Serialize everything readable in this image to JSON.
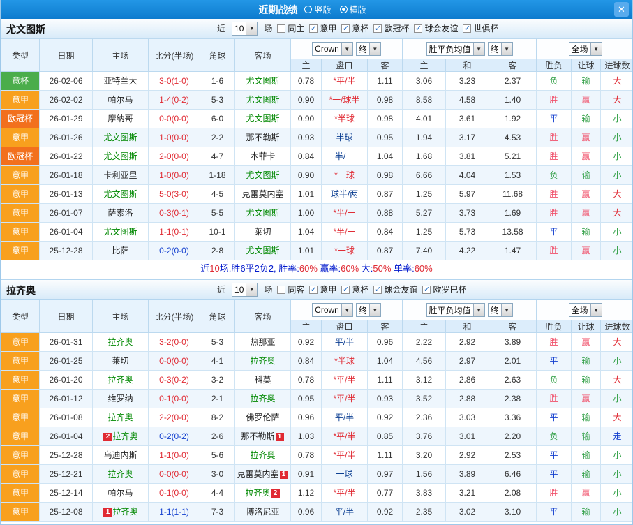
{
  "header": {
    "title": "近期战绩",
    "radio_vertical": "竖版",
    "radio_horizontal": "横版",
    "selected_layout": "横版",
    "close_label": "✕"
  },
  "table_headers": {
    "type": "类型",
    "date": "日期",
    "home": "主场",
    "score": "比分(半场)",
    "corner": "角球",
    "away": "客场",
    "odds_home": "主",
    "handicap": "盘口",
    "odds_away": "客",
    "avg_home": "主",
    "avg_draw": "和",
    "avg_away": "客",
    "result": "胜负",
    "handicap_result": "让球",
    "goals": "进球数",
    "odds_source": "Crown",
    "final1": "终",
    "avg_label": "胜平负均值",
    "final2": "终",
    "scope": "全场"
  },
  "colors": {
    "leagues": {
      "意甲": "#f8a01e",
      "意杯": "#4bad4b",
      "欧冠杯": "#f2701d"
    },
    "focus_team": "#008800",
    "score": {
      "r": "#e02a33",
      "b": "#1440cf"
    },
    "handicap_star": "#e02a33",
    "handicap_plain": "#0a3d91",
    "result": {
      "胜": "#f0506a",
      "负": "#2f9e44",
      "平": "#1440cf",
      "赢": "#f0506a",
      "输": "#2f9e44",
      "大": "#e02a33",
      "小": "#2f9e44",
      "走": "#1440cf"
    },
    "summary_blue": "#0018cc",
    "summary_red": "#e02a33"
  },
  "sections": [
    {
      "team": "尤文图斯",
      "filter": {
        "near_label": "近",
        "count": "10",
        "unit": "场",
        "checkboxes": [
          {
            "label": "同主",
            "checked": false
          },
          {
            "label": "意甲",
            "checked": true
          },
          {
            "label": "意杯",
            "checked": true
          },
          {
            "label": "欧冠杯",
            "checked": true
          },
          {
            "label": "球会友谊",
            "checked": true
          },
          {
            "label": "世俱杯",
            "checked": true
          }
        ]
      },
      "rows": [
        {
          "lg": "意杯",
          "date": "26-02-06",
          "h": "亚特兰大",
          "hf": false,
          "s": "3-0(1-0)",
          "sc": "r",
          "cn": "1-6",
          "a": "尤文图斯",
          "af": true,
          "o1": "0.78",
          "hc": "*平/半",
          "o2": "1.11",
          "m1": "3.06",
          "m2": "3.23",
          "m3": "2.37",
          "r1": "负",
          "r2": "输",
          "r3": "大"
        },
        {
          "lg": "意甲",
          "date": "26-02-02",
          "h": "帕尔马",
          "hf": false,
          "s": "1-4(0-2)",
          "sc": "r",
          "cn": "5-3",
          "a": "尤文图斯",
          "af": true,
          "o1": "0.90",
          "hc": "*一/球半",
          "o2": "0.98",
          "m1": "8.58",
          "m2": "4.58",
          "m3": "1.40",
          "r1": "胜",
          "r2": "赢",
          "r3": "大"
        },
        {
          "lg": "欧冠杯",
          "date": "26-01-29",
          "h": "摩纳哥",
          "hf": false,
          "s": "0-0(0-0)",
          "sc": "r",
          "cn": "6-0",
          "a": "尤文图斯",
          "af": true,
          "o1": "0.90",
          "hc": "*半球",
          "o2": "0.98",
          "m1": "4.01",
          "m2": "3.61",
          "m3": "1.92",
          "r1": "平",
          "r2": "输",
          "r3": "小"
        },
        {
          "lg": "意甲",
          "date": "26-01-26",
          "h": "尤文图斯",
          "hf": true,
          "s": "1-0(0-0)",
          "sc": "r",
          "cn": "2-2",
          "a": "那不勒斯",
          "af": false,
          "o1": "0.93",
          "hc": "半球",
          "o2": "0.95",
          "m1": "1.94",
          "m2": "3.17",
          "m3": "4.53",
          "r1": "胜",
          "r2": "赢",
          "r3": "小"
        },
        {
          "lg": "欧冠杯",
          "date": "26-01-22",
          "h": "尤文图斯",
          "hf": true,
          "s": "2-0(0-0)",
          "sc": "r",
          "cn": "4-7",
          "a": "本菲卡",
          "af": false,
          "o1": "0.84",
          "hc": "半/一",
          "o2": "1.04",
          "m1": "1.68",
          "m2": "3.81",
          "m3": "5.21",
          "r1": "胜",
          "r2": "赢",
          "r3": "小"
        },
        {
          "lg": "意甲",
          "date": "26-01-18",
          "h": "卡利亚里",
          "hf": false,
          "s": "1-0(0-0)",
          "sc": "r",
          "cn": "1-18",
          "a": "尤文图斯",
          "af": true,
          "o1": "0.90",
          "hc": "*一球",
          "o2": "0.98",
          "m1": "6.66",
          "m2": "4.04",
          "m3": "1.53",
          "r1": "负",
          "r2": "输",
          "r3": "小"
        },
        {
          "lg": "意甲",
          "date": "26-01-13",
          "h": "尤文图斯",
          "hf": true,
          "s": "5-0(3-0)",
          "sc": "r",
          "cn": "4-5",
          "a": "克雷莫内塞",
          "af": false,
          "o1": "1.01",
          "hc": "球半/两",
          "o2": "0.87",
          "m1": "1.25",
          "m2": "5.97",
          "m3": "11.68",
          "r1": "胜",
          "r2": "赢",
          "r3": "大"
        },
        {
          "lg": "意甲",
          "date": "26-01-07",
          "h": "萨索洛",
          "hf": false,
          "s": "0-3(0-1)",
          "sc": "r",
          "cn": "5-5",
          "a": "尤文图斯",
          "af": true,
          "o1": "1.00",
          "hc": "*半/一",
          "o2": "0.88",
          "m1": "5.27",
          "m2": "3.73",
          "m3": "1.69",
          "r1": "胜",
          "r2": "赢",
          "r3": "大"
        },
        {
          "lg": "意甲",
          "date": "26-01-04",
          "h": "尤文图斯",
          "hf": true,
          "s": "1-1(0-1)",
          "sc": "r",
          "cn": "10-1",
          "a": "莱切",
          "af": false,
          "o1": "1.04",
          "hc": "*半/一",
          "o2": "0.84",
          "m1": "1.25",
          "m2": "5.73",
          "m3": "13.58",
          "r1": "平",
          "r2": "输",
          "r3": "小"
        },
        {
          "lg": "意甲",
          "date": "25-12-28",
          "h": "比萨",
          "hf": false,
          "s": "0-2(0-0)",
          "sc": "b",
          "cn": "2-8",
          "a": "尤文图斯",
          "af": true,
          "o1": "1.01",
          "hc": "*一球",
          "o2": "0.87",
          "m1": "7.40",
          "m2": "4.22",
          "m3": "1.47",
          "r1": "胜",
          "r2": "赢",
          "r3": "小"
        }
      ],
      "summary": [
        {
          "t": "近",
          "c": "b"
        },
        {
          "t": "10",
          "c": "r"
        },
        {
          "t": "场,胜6平2负2, 胜率:",
          "c": "b"
        },
        {
          "t": "60%",
          "c": "r"
        },
        {
          "t": " 赢率:",
          "c": "b"
        },
        {
          "t": "60%",
          "c": "r"
        },
        {
          "t": " 大:",
          "c": "b"
        },
        {
          "t": "50%",
          "c": "r"
        },
        {
          "t": " 单率:",
          "c": "b"
        },
        {
          "t": "60%",
          "c": "r"
        }
      ]
    },
    {
      "team": "拉齐奥",
      "filter": {
        "near_label": "近",
        "count": "10",
        "unit": "场",
        "checkboxes": [
          {
            "label": "同客",
            "checked": false
          },
          {
            "label": "意甲",
            "checked": true
          },
          {
            "label": "意杯",
            "checked": true
          },
          {
            "label": "球会友谊",
            "checked": true
          },
          {
            "label": "欧罗巴杯",
            "checked": true
          }
        ]
      },
      "rows": [
        {
          "lg": "意甲",
          "date": "26-01-31",
          "h": "拉齐奥",
          "hf": true,
          "s": "3-2(0-0)",
          "sc": "r",
          "cn": "5-3",
          "a": "热那亚",
          "af": false,
          "o1": "0.92",
          "hc": "平/半",
          "o2": "0.96",
          "m1": "2.22",
          "m2": "2.92",
          "m3": "3.89",
          "r1": "胜",
          "r2": "赢",
          "r3": "大"
        },
        {
          "lg": "意甲",
          "date": "26-01-25",
          "h": "莱切",
          "hf": false,
          "s": "0-0(0-0)",
          "sc": "r",
          "cn": "4-1",
          "a": "拉齐奥",
          "af": true,
          "o1": "0.84",
          "hc": "*半球",
          "o2": "1.04",
          "m1": "4.56",
          "m2": "2.97",
          "m3": "2.01",
          "r1": "平",
          "r2": "输",
          "r3": "小"
        },
        {
          "lg": "意甲",
          "date": "26-01-20",
          "h": "拉齐奥",
          "hf": true,
          "s": "0-3(0-2)",
          "sc": "r",
          "cn": "3-2",
          "a": "科莫",
          "af": false,
          "o1": "0.78",
          "hc": "*平/半",
          "o2": "1.11",
          "m1": "3.12",
          "m2": "2.86",
          "m3": "2.63",
          "r1": "负",
          "r2": "输",
          "r3": "大"
        },
        {
          "lg": "意甲",
          "date": "26-01-12",
          "h": "维罗纳",
          "hf": false,
          "s": "0-1(0-0)",
          "sc": "r",
          "cn": "2-1",
          "a": "拉齐奥",
          "af": true,
          "o1": "0.95",
          "hc": "*平/半",
          "o2": "0.93",
          "m1": "3.52",
          "m2": "2.88",
          "m3": "2.38",
          "r1": "胜",
          "r2": "赢",
          "r3": "小"
        },
        {
          "lg": "意甲",
          "date": "26-01-08",
          "h": "拉齐奥",
          "hf": true,
          "s": "2-2(0-0)",
          "sc": "r",
          "cn": "8-2",
          "a": "佛罗伦萨",
          "af": false,
          "o1": "0.96",
          "hc": "平/半",
          "o2": "0.92",
          "m1": "2.36",
          "m2": "3.03",
          "m3": "3.36",
          "r1": "平",
          "r2": "输",
          "r3": "大"
        },
        {
          "lg": "意甲",
          "date": "26-01-04",
          "h": "拉齐奥",
          "hf": true,
          "hb": {
            "n": "2",
            "p": "l"
          },
          "s": "0-2(0-2)",
          "sc": "b",
          "cn": "2-6",
          "a": "那不勒斯",
          "af": false,
          "ab": {
            "n": "1",
            "p": "r"
          },
          "o1": "1.03",
          "hc": "*平/半",
          "o2": "0.85",
          "m1": "3.76",
          "m2": "3.01",
          "m3": "2.20",
          "r1": "负",
          "r2": "输",
          "r3": "走"
        },
        {
          "lg": "意甲",
          "date": "25-12-28",
          "h": "乌迪内斯",
          "hf": false,
          "s": "1-1(0-0)",
          "sc": "r",
          "cn": "5-6",
          "a": "拉齐奥",
          "af": true,
          "o1": "0.78",
          "hc": "*平/半",
          "o2": "1.11",
          "m1": "3.20",
          "m2": "2.92",
          "m3": "2.53",
          "r1": "平",
          "r2": "输",
          "r3": "小"
        },
        {
          "lg": "意甲",
          "date": "25-12-21",
          "h": "拉齐奥",
          "hf": true,
          "s": "0-0(0-0)",
          "sc": "r",
          "cn": "3-0",
          "a": "克雷莫内塞",
          "af": false,
          "ab": {
            "n": "1",
            "p": "r"
          },
          "o1": "0.91",
          "hc": "一球",
          "o2": "0.97",
          "m1": "1.56",
          "m2": "3.89",
          "m3": "6.46",
          "r1": "平",
          "r2": "输",
          "r3": "小"
        },
        {
          "lg": "意甲",
          "date": "25-12-14",
          "h": "帕尔马",
          "hf": false,
          "s": "0-1(0-0)",
          "sc": "r",
          "cn": "4-4",
          "a": "拉齐奥",
          "af": true,
          "ab": {
            "n": "2",
            "p": "r"
          },
          "o1": "1.12",
          "hc": "*平/半",
          "o2": "0.77",
          "m1": "3.83",
          "m2": "3.21",
          "m3": "2.08",
          "r1": "胜",
          "r2": "赢",
          "r3": "小"
        },
        {
          "lg": "意甲",
          "date": "25-12-08",
          "h": "拉齐奥",
          "hf": true,
          "hb": {
            "n": "1",
            "p": "l"
          },
          "s": "1-1(1-1)",
          "sc": "b",
          "cn": "7-3",
          "a": "博洛尼亚",
          "af": false,
          "o1": "0.96",
          "hc": "平/半",
          "o2": "0.92",
          "m1": "2.35",
          "m2": "3.02",
          "m3": "3.10",
          "r1": "平",
          "r2": "输",
          "r3": "小"
        }
      ],
      "summary": null
    }
  ]
}
